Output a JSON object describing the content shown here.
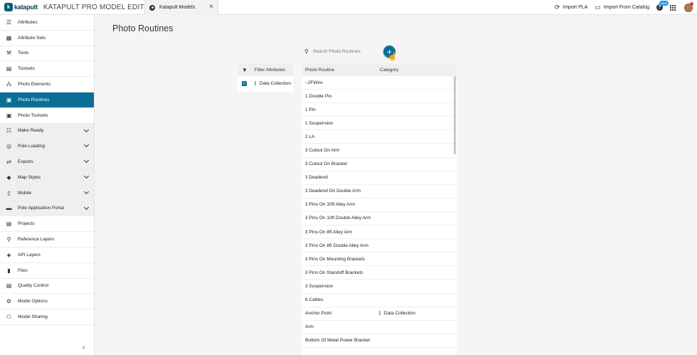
{
  "app": {
    "logo_text": "katapult",
    "title": "KATAPULT PRO MODEL EDITOR"
  },
  "tab": {
    "label": "Katapult Models",
    "close": "×"
  },
  "top_actions": {
    "import_pla": "Import PLA",
    "import_catalog": "Import From Catalog",
    "help": "?",
    "badge": "NEW"
  },
  "sidebar": {
    "items": [
      {
        "label": "Attributes",
        "icon": "list-icon",
        "glyph": "☰",
        "group": false
      },
      {
        "label": "Attribute Sets",
        "icon": "table-icon",
        "glyph": "▦",
        "group": false
      },
      {
        "label": "Tools",
        "icon": "tools-icon",
        "glyph": "⚒",
        "group": false
      },
      {
        "label": "Toolsets",
        "icon": "toolbox-icon",
        "glyph": "▤",
        "group": false
      },
      {
        "label": "Photo Elements",
        "icon": "shapes-icon",
        "glyph": "⁂",
        "group": false
      },
      {
        "label": "Photo Routines",
        "icon": "photo-routine-icon",
        "glyph": "▣",
        "group": false,
        "active": true
      },
      {
        "label": "Photo Toolsets",
        "icon": "photo-toolset-icon",
        "glyph": "▣",
        "group": false
      },
      {
        "label": "Make Ready",
        "icon": "make-ready-icon",
        "glyph": "☷",
        "group": true
      },
      {
        "label": "Pole Loading",
        "icon": "pole-loading-icon",
        "glyph": "◎",
        "group": true
      },
      {
        "label": "Exports",
        "icon": "exports-icon",
        "glyph": "⇄",
        "group": true
      },
      {
        "label": "Map Styles",
        "icon": "map-styles-icon",
        "glyph": "◆",
        "group": true
      },
      {
        "label": "Mobile",
        "icon": "mobile-icon",
        "glyph": "▯",
        "group": true
      },
      {
        "label": "Pole Application Portal",
        "icon": "portal-icon",
        "glyph": "▬",
        "group": true
      },
      {
        "label": "Projects",
        "icon": "projects-icon",
        "glyph": "▤",
        "group": false
      },
      {
        "label": "Reference Layers",
        "icon": "location-icon",
        "glyph": "⚲",
        "group": false
      },
      {
        "label": "API Layers",
        "icon": "layers-icon",
        "glyph": "◈",
        "group": false
      },
      {
        "label": "Files",
        "icon": "file-icon",
        "glyph": "▮",
        "group": false
      },
      {
        "label": "Quality Control",
        "icon": "quality-icon",
        "glyph": "▤",
        "group": false
      },
      {
        "label": "Model Options",
        "icon": "gear-icon",
        "glyph": "⚙",
        "group": false
      },
      {
        "label": "Model Sharing",
        "icon": "sharing-icon",
        "glyph": "⚇",
        "group": false
      }
    ],
    "collapse": "‹"
  },
  "main": {
    "page_title": "Photo Routines",
    "search_placeholder": "Search Photo Routines",
    "add": "+"
  },
  "filter": {
    "header": "Filter Attributes",
    "option": "Data Collection",
    "checked": true
  },
  "table": {
    "columns": [
      "Photo Routine",
      "Category"
    ],
    "rows": [
      {
        "name": "~2FWire",
        "category": ""
      },
      {
        "name": "1 Double Pin",
        "category": ""
      },
      {
        "name": "1 Pin",
        "category": ""
      },
      {
        "name": "1 Suspension",
        "category": ""
      },
      {
        "name": "2 LA",
        "category": ""
      },
      {
        "name": "3 Cutout On Arm",
        "category": ""
      },
      {
        "name": "3 Cutout On Bracket",
        "category": ""
      },
      {
        "name": "3 Deadend",
        "category": ""
      },
      {
        "name": "3 Deadend On Double Arm",
        "category": ""
      },
      {
        "name": "3 Pins On 10ft Alley Arm",
        "category": ""
      },
      {
        "name": "3 Pins On 10ft Double Alley Arm",
        "category": ""
      },
      {
        "name": "3 Pins On 8ft Alley Arm",
        "category": ""
      },
      {
        "name": "3 Pins On 8ft Double Alley Arm",
        "category": ""
      },
      {
        "name": "3 Pins On Mounting Brackets",
        "category": ""
      },
      {
        "name": "3 Pins On Standoff Brackets",
        "category": ""
      },
      {
        "name": "3 Suspension",
        "category": ""
      },
      {
        "name": "6 Cables",
        "category": ""
      },
      {
        "name": "Anchor Point",
        "category": "Data Collection"
      },
      {
        "name": "Arm",
        "category": ""
      },
      {
        "name": "Bottom Of Metal Power Bracket",
        "category": ""
      }
    ]
  }
}
